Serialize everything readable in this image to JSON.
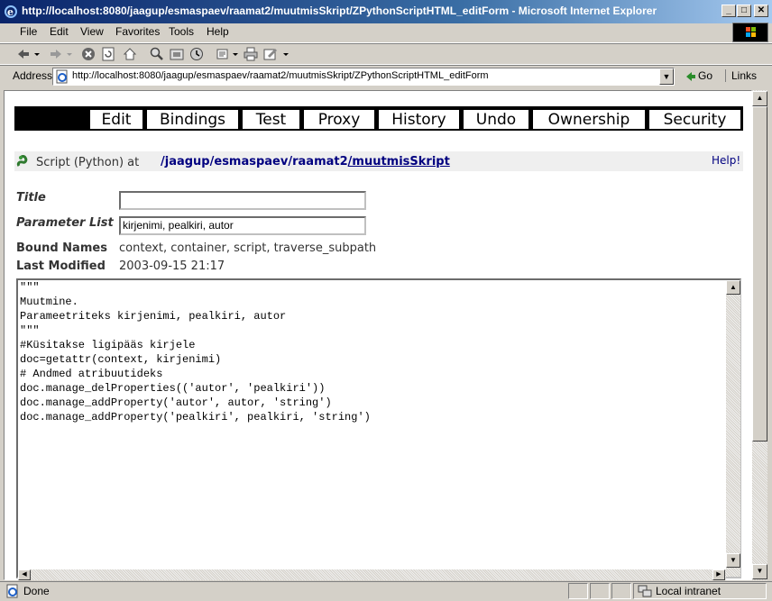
{
  "window": {
    "title": "http://localhost:8080/jaagup/esmaspaev/raamat2/muutmisSkript/ZPythonScriptHTML_editForm - Microsoft Internet Explorer",
    "min_glyph": "_",
    "max_glyph": "□",
    "close_glyph": "✕"
  },
  "menu": {
    "file": "File",
    "edit": "Edit",
    "view": "View",
    "favorites": "Favorites",
    "tools": "Tools",
    "help": "Help"
  },
  "address": {
    "label": "Address",
    "url": "http://localhost:8080/jaagup/esmaspaev/raamat2/muutmisSkript/ZPythonScriptHTML_editForm",
    "go": "Go",
    "links": "Links"
  },
  "tabs": [
    {
      "label": "Edit"
    },
    {
      "label": "Bindings"
    },
    {
      "label": "Test"
    },
    {
      "label": "Proxy"
    },
    {
      "label": "History"
    },
    {
      "label": "Undo"
    },
    {
      "label": "Ownership"
    },
    {
      "label": "Security"
    }
  ],
  "header": {
    "type_label": "Script (Python) at",
    "path": [
      "/jaagup",
      "/esmaspaev",
      "/raamat2",
      "/muutmisSkript"
    ],
    "help": "Help!"
  },
  "form": {
    "title_label": "Title",
    "title_value": "",
    "params_label": "Parameter List",
    "params_value": "kirjenimi, pealkiri, autor",
    "bound_label": "Bound Names",
    "bound_value": "context, container, script, traverse_subpath",
    "modified_label": "Last Modified",
    "modified_value": "2003-09-15 21:17"
  },
  "code": "\"\"\"\nMuutmine.\nParameetriteks kirjenimi, pealkiri, autor\n\"\"\"\n#Küsitakse ligipääs kirjele\ndoc=getattr(context, kirjenimi)\n# Andmed atribuutideks\ndoc.manage_delProperties(('autor', 'pealkiri'))\ndoc.manage_addProperty('autor', autor, 'string')\ndoc.manage_addProperty('pealkiri', pealkiri, 'string')",
  "status": {
    "text": "Done",
    "zone": "Local intranet"
  }
}
